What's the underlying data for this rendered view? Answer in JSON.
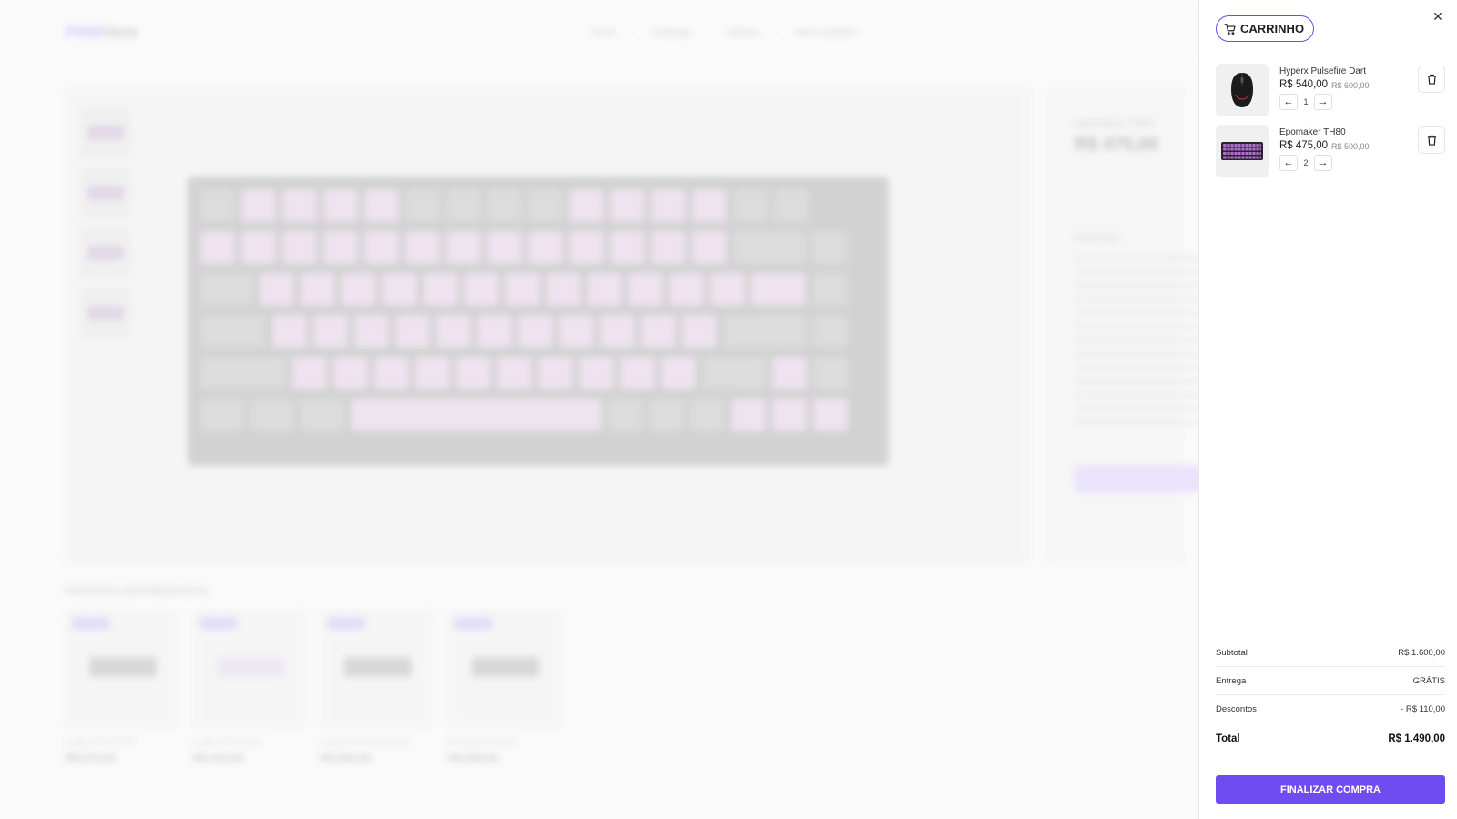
{
  "store": {
    "logo_brand": "PSW",
    "logo_suffix": "Store",
    "nav": [
      "Início",
      "Catálogo",
      "Ofertas",
      "Meus pedidos"
    ],
    "product_name": "Epomaker TH80",
    "product_price": "R$ 475,00",
    "description_label": "Descrição",
    "recommended_title": "PRODUTOS RECOMENDADOS",
    "recommended": [
      {
        "name": "Logitech G915 TKL",
        "price": "R$ 675,00"
      },
      {
        "name": "Logitech Pop Keys",
        "price": "R$ 415,00"
      },
      {
        "name": "Logitech MX Mechanical",
        "price": "R$ 555,00"
      },
      {
        "name": "Redragon Kumara",
        "price": "R$ 255,00"
      }
    ]
  },
  "cart": {
    "title": "CARRINHO",
    "close_icon": "close-icon",
    "items": [
      {
        "name": "Hyperx Pulsefire Dart",
        "price": "R$ 540,00",
        "old_price": "R$ 600,00",
        "qty": "1",
        "image": "mouse-image"
      },
      {
        "name": "Epomaker TH80",
        "price": "R$ 475,00",
        "old_price": "R$ 500,00",
        "qty": "2",
        "image": "keyboard-image"
      }
    ],
    "summary": {
      "subtotal_label": "Subtotal",
      "subtotal_value": "R$ 1.600,00",
      "shipping_label": "Entrega",
      "shipping_value": "GRÁTIS",
      "discount_label": "Descontos",
      "discount_value": "- R$ 110,00",
      "total_label": "Total",
      "total_value": "R$ 1.490,00"
    },
    "checkout_label": "FINALIZAR COMPRA",
    "accent_color": "#6e4cf0"
  }
}
